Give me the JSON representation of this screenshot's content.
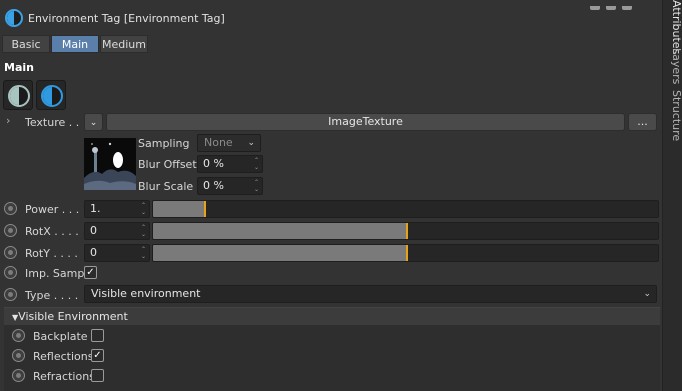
{
  "header": {
    "title": "Environment Tag [Environment Tag]"
  },
  "side_tabs": [
    {
      "label": "Attributes"
    },
    {
      "label": "Layers"
    },
    {
      "label": "Structure"
    }
  ],
  "mode_tabs": [
    {
      "label": "Basic",
      "active": false
    },
    {
      "label": "Main",
      "active": true
    },
    {
      "label": "Medium",
      "active": false
    }
  ],
  "section": {
    "title": "Main"
  },
  "texture": {
    "label": "Texture . .",
    "value": "ImageTexture",
    "more_label": "...",
    "sampling_label": "Sampling",
    "sampling_value": "None",
    "blur_offset_label": "Blur Offset",
    "blur_offset_value": "0 %",
    "blur_scale_label": "Blur Scale",
    "blur_scale_value": "0 %"
  },
  "params": {
    "power": {
      "label": "Power . . .",
      "value": "1.",
      "slider_fraction": 0.1
    },
    "rotx": {
      "label": "RotX . . . .",
      "value": "0",
      "slider_fraction": 0.5
    },
    "roty": {
      "label": "RotY . . . .",
      "value": "0",
      "slider_fraction": 0.5
    },
    "imp_samp": {
      "label": "Imp. Samp.",
      "checked": true
    },
    "type": {
      "label": "Type . . . .",
      "value": "Visible environment"
    }
  },
  "visible_environment": {
    "title": "Visible Environment",
    "backplate": {
      "label": "Backplate",
      "checked": false
    },
    "reflections": {
      "label": "Reflections",
      "checked": true
    },
    "refractions": {
      "label": "Refractions",
      "checked": false
    }
  },
  "colors": {
    "accent_blue": "#3aa3e6",
    "active_tab": "#5a7faa",
    "slider_marker": "#e8a21a"
  }
}
